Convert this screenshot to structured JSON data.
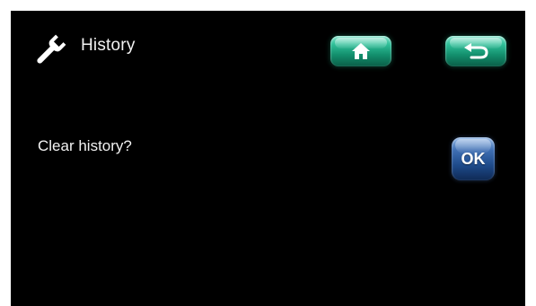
{
  "header": {
    "icon": "wrench-icon",
    "title": "History",
    "home_button": {
      "icon": "home-icon",
      "color": "#1fa37e"
    },
    "back_button": {
      "icon": "back-arrow-icon",
      "color": "#1fa37e"
    }
  },
  "dialog": {
    "prompt": "Clear history?",
    "ok_button": {
      "label": "OK",
      "color": "#2a5ba0"
    }
  },
  "theme": {
    "background": "#000000",
    "text": "#f2f2f2"
  }
}
